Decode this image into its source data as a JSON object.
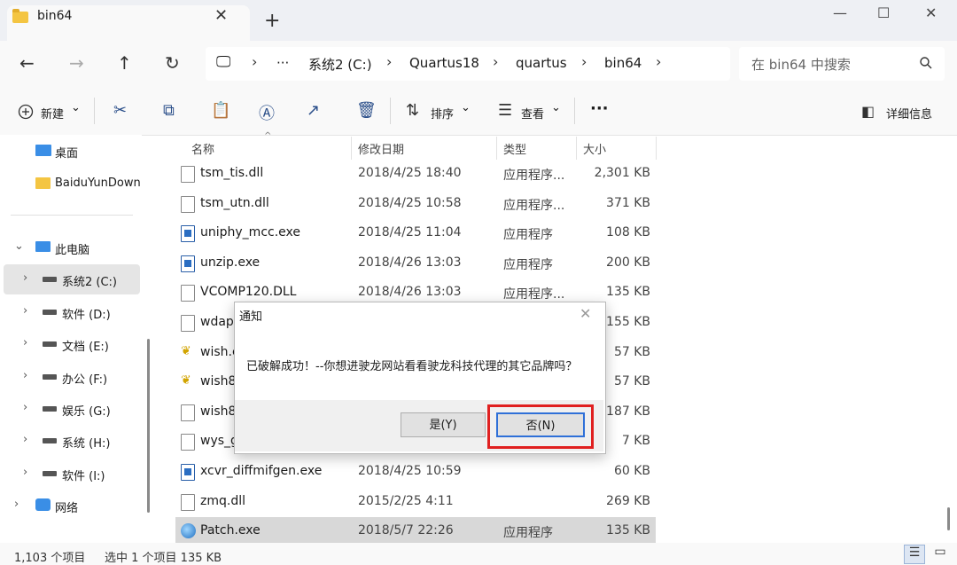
{
  "window": {
    "tab_title": "bin64",
    "tab_close": "✕",
    "new_tab": "+",
    "minimize": "—",
    "maximize": "☐",
    "close": "✕"
  },
  "nav": {
    "back": "←",
    "forward": "→",
    "up": "↑",
    "refresh": "↻"
  },
  "address": {
    "pc": "🖵",
    "more": "···",
    "crumbs": [
      "系统2 (C:)",
      "Quartus18",
      "quartus",
      "bin64"
    ],
    "sep": "›",
    "search_placeholder": "在 bin64 中搜索"
  },
  "toolbar": {
    "new_label": "新建",
    "sort_label": "排序",
    "view_label": "查看",
    "more": "···",
    "details_label": "详细信息",
    "dropdown": "⌄"
  },
  "sidebar": {
    "desktop": "桌面",
    "baidu": "BaiduYunDown",
    "this_pc": "此电脑",
    "drives": [
      "系统2 (C:)",
      "软件 (D:)",
      "文档 (E:)",
      "办公 (F:)",
      "娱乐 (G:)",
      "系统 (H:)",
      "软件 (I:)"
    ],
    "network": "网络"
  },
  "columns": {
    "name": "名称",
    "date": "修改日期",
    "type": "类型",
    "size": "大小"
  },
  "files": [
    {
      "name": "tsm_tis.dll",
      "date": "2018/4/25 18:40",
      "type": "应用程序...",
      "size": "2,301 KB",
      "icon": "dll"
    },
    {
      "name": "tsm_utn.dll",
      "date": "2018/4/25 10:58",
      "type": "应用程序...",
      "size": "371 KB",
      "icon": "dll"
    },
    {
      "name": "uniphy_mcc.exe",
      "date": "2018/4/25 11:04",
      "type": "应用程序",
      "size": "108 KB",
      "icon": "exe"
    },
    {
      "name": "unzip.exe",
      "date": "2018/4/26 13:03",
      "type": "应用程序",
      "size": "200 KB",
      "icon": "exe"
    },
    {
      "name": "VCOMP120.DLL",
      "date": "2018/4/26 13:03",
      "type": "应用程序...",
      "size": "135 KB",
      "icon": "dll"
    },
    {
      "name": "wdapi",
      "date": "",
      "type": "",
      "size": "155 KB",
      "icon": "dll"
    },
    {
      "name": "wish.e",
      "date": "",
      "type": "",
      "size": "57 KB",
      "icon": "wish"
    },
    {
      "name": "wish8",
      "date": "",
      "type": "",
      "size": "57 KB",
      "icon": "wish"
    },
    {
      "name": "wish8",
      "date": "",
      "type": "",
      "size": "187 KB",
      "icon": "file"
    },
    {
      "name": "wys_g",
      "date": "",
      "type": "",
      "size": "7 KB",
      "icon": "file"
    },
    {
      "name": "xcvr_diffmifgen.exe",
      "date": "2018/4/25 10:59",
      "type": "",
      "size": "60 KB",
      "icon": "exe"
    },
    {
      "name": "zmq.dll",
      "date": "2015/2/25 4:11",
      "type": "",
      "size": "269 KB",
      "icon": "dll"
    },
    {
      "name": "Patch.exe",
      "date": "2018/5/7 22:26",
      "type": "应用程序",
      "size": "135 KB",
      "icon": "patch",
      "selected": true
    }
  ],
  "status": {
    "count": "1,103 个项目",
    "selection": "选中 1 个项目  135 KB"
  },
  "dialog": {
    "title": "通知",
    "close": "✕",
    "message": "已破解成功！--你想进驶龙网站看看驶龙科技代理的其它品牌吗？",
    "yes": "是(Y)",
    "no": "否(N)"
  }
}
